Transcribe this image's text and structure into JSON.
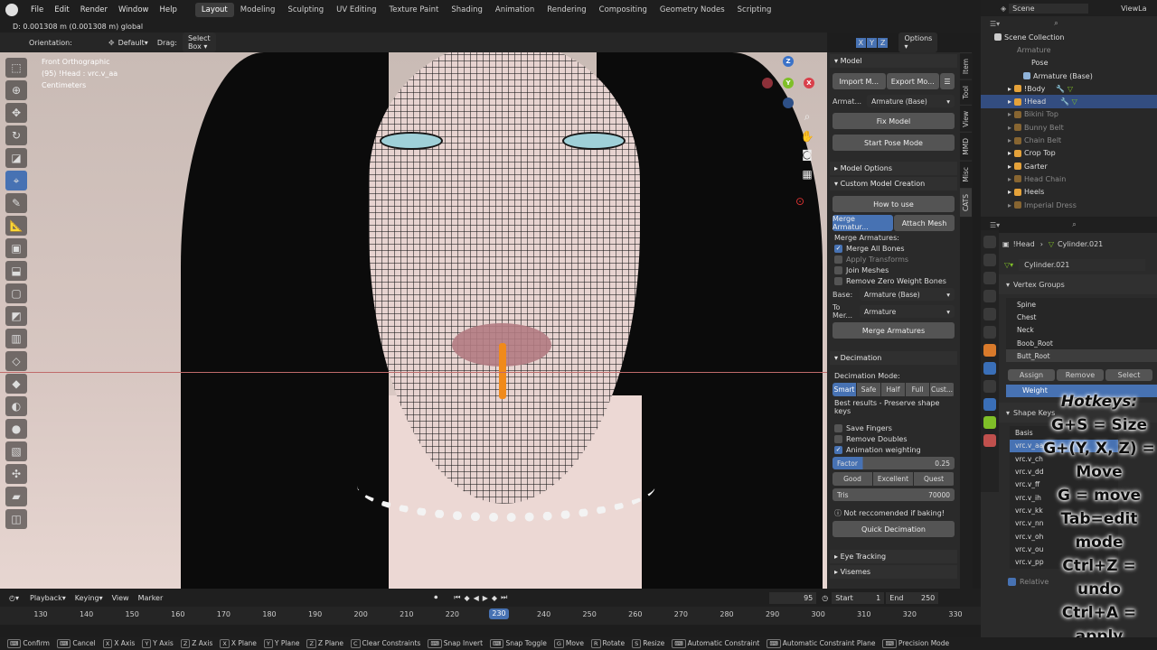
{
  "topbar": {
    "menus": [
      "File",
      "Edit",
      "Render",
      "Window",
      "Help"
    ],
    "workspaces": [
      "Layout",
      "Modeling",
      "Sculpting",
      "UV Editing",
      "Texture Paint",
      "Shading",
      "Animation",
      "Rendering",
      "Compositing",
      "Geometry Nodes",
      "Scripting"
    ],
    "scene_label": "Scene",
    "viewlayer_label": "ViewLa"
  },
  "header": {
    "status_text": "D: 0.001308 m (0.001308 m) global",
    "orientation_label": "Orientation:",
    "orientation_value": "Default",
    "drag_label": "Drag:",
    "drag_value": "Select Box",
    "axes": [
      "X",
      "Y",
      "Z"
    ],
    "options_label": "Options"
  },
  "viewport": {
    "info_line1": "Front Orthographic",
    "info_line2": "(95) !Head : vrc.v_aa",
    "info_line3": "Centimeters",
    "gizmo_axes": [
      "X",
      "Y",
      "Z"
    ]
  },
  "npanel": {
    "tabs": [
      "Item",
      "Tool",
      "View",
      "MMD",
      "Misc",
      "CATS"
    ],
    "model_title": "Model",
    "import_label": "Import M...",
    "export_label": "Export Mo...",
    "armature_label": "Armat...",
    "armature_value": "Armature (Base)",
    "fix_model": "Fix Model",
    "start_pose": "Start Pose Mode",
    "model_options": "Model Options",
    "custom_model": "Custom Model Creation",
    "how_to_use": "How to use",
    "merge_armature_btn": "Merge Armatur...",
    "attach_mesh_btn": "Attach Mesh",
    "merge_armatures_label": "Merge Armatures:",
    "merge_all_bones": "Merge All Bones",
    "apply_transforms": "Apply Transforms",
    "join_meshes": "Join Meshes",
    "remove_zero": "Remove Zero Weight Bones",
    "base_label": "Base:",
    "base_value": "Armature (Base)",
    "tomer_label": "To Mer...",
    "tomer_value": "Armature",
    "merge_armatures_btn": "Merge Armatures",
    "decimation_title": "Decimation",
    "decimation_mode_label": "Decimation Mode:",
    "decimation_modes": [
      "Smart",
      "Safe",
      "Half",
      "Full",
      "Cust..."
    ],
    "best_results": "Best results - Preserve shape keys",
    "save_fingers": "Save Fingers",
    "remove_doubles": "Remove Doubles",
    "anim_weighting": "Animation weighting",
    "factor_label": "Factor",
    "factor_value": "0.25",
    "quality": [
      "Good",
      "Excellent",
      "Quest"
    ],
    "tris_label": "Tris",
    "tris_value": "70000",
    "warning": "Not reccomended if baking!",
    "quick_decimation": "Quick Decimation",
    "eye_tracking": "Eye Tracking",
    "visemes": "Visemes"
  },
  "outliner": {
    "scene_collection": "Scene Collection",
    "items": [
      {
        "label": "Armature",
        "dim": true
      },
      {
        "label": "Pose",
        "dim": false
      },
      {
        "label": "Armature (Base)",
        "dim": false
      },
      {
        "label": "!Body",
        "dim": false
      },
      {
        "label": "!Head",
        "dim": false,
        "selected": true
      },
      {
        "label": "Bikini Top",
        "dim": true
      },
      {
        "label": "Bunny Belt",
        "dim": true
      },
      {
        "label": "Chain Belt",
        "dim": true
      },
      {
        "label": "Crop Top",
        "dim": false
      },
      {
        "label": "Garter",
        "dim": false
      },
      {
        "label": "Head Chain",
        "dim": true
      },
      {
        "label": "Heels",
        "dim": false
      },
      {
        "label": "Imperial Dress",
        "dim": true
      }
    ]
  },
  "properties": {
    "breadcrumb_obj": "!Head",
    "breadcrumb_mesh": "Cylinder.021",
    "mesh_name": "Cylinder.021",
    "vertex_groups_title": "Vertex Groups",
    "vertex_groups": [
      "Spine",
      "Chest",
      "Neck",
      "Boob_Root",
      "Butt_Root"
    ],
    "assign": "Assign",
    "remove": "Remove",
    "select": "Select",
    "weight": "Weight",
    "shape_keys_title": "Shape Keys",
    "shape_keys": [
      "Basis",
      "vrc.v_aa",
      "vrc.v_ch",
      "vrc.v_dd",
      "vrc.v_ff",
      "vrc.v_ih",
      "vrc.v_kk",
      "vrc.v_nn",
      "vrc.v_oh",
      "vrc.v_ou",
      "vrc.v_pp"
    ],
    "relative": "Relative"
  },
  "hotkeys": {
    "lines": [
      "Hotkeys:",
      "G+S = Size",
      "G+(Y, X, Z) =",
      "Move",
      "G = move",
      "Tab=edit",
      "mode",
      "Ctrl+Z =",
      "undo",
      "Ctrl+A =",
      "apply"
    ]
  },
  "timeline": {
    "menus": [
      "Playback",
      "Keying",
      "View",
      "Marker"
    ],
    "current_frame": "95",
    "start_label": "Start",
    "start_value": "1",
    "end_label": "End",
    "end_value": "250",
    "ticks": [
      "130",
      "140",
      "150",
      "160",
      "170",
      "180",
      "190",
      "200",
      "210",
      "220",
      "230",
      "240",
      "250",
      "260",
      "270",
      "280",
      "290",
      "300",
      "310",
      "320",
      "330"
    ],
    "cursor_frame": "230"
  },
  "statusbar": [
    {
      "key": "",
      "label": "Confirm"
    },
    {
      "key": "",
      "label": "Cancel"
    },
    {
      "key": "X",
      "label": "X Axis"
    },
    {
      "key": "Y",
      "label": "Y Axis"
    },
    {
      "key": "Z",
      "label": "Z Axis"
    },
    {
      "key": "X",
      "label": "X Plane"
    },
    {
      "key": "Y",
      "label": "Y Plane"
    },
    {
      "key": "Z",
      "label": "Z Plane"
    },
    {
      "key": "C",
      "label": "Clear Constraints"
    },
    {
      "key": "",
      "label": "Snap Invert"
    },
    {
      "key": "",
      "label": "Snap Toggle"
    },
    {
      "key": "G",
      "label": "Move"
    },
    {
      "key": "R",
      "label": "Rotate"
    },
    {
      "key": "S",
      "label": "Resize"
    },
    {
      "key": "",
      "label": "Automatic Constraint"
    },
    {
      "key": "",
      "label": "Automatic Constraint Plane"
    },
    {
      "key": "",
      "label": "Precision Mode"
    }
  ]
}
